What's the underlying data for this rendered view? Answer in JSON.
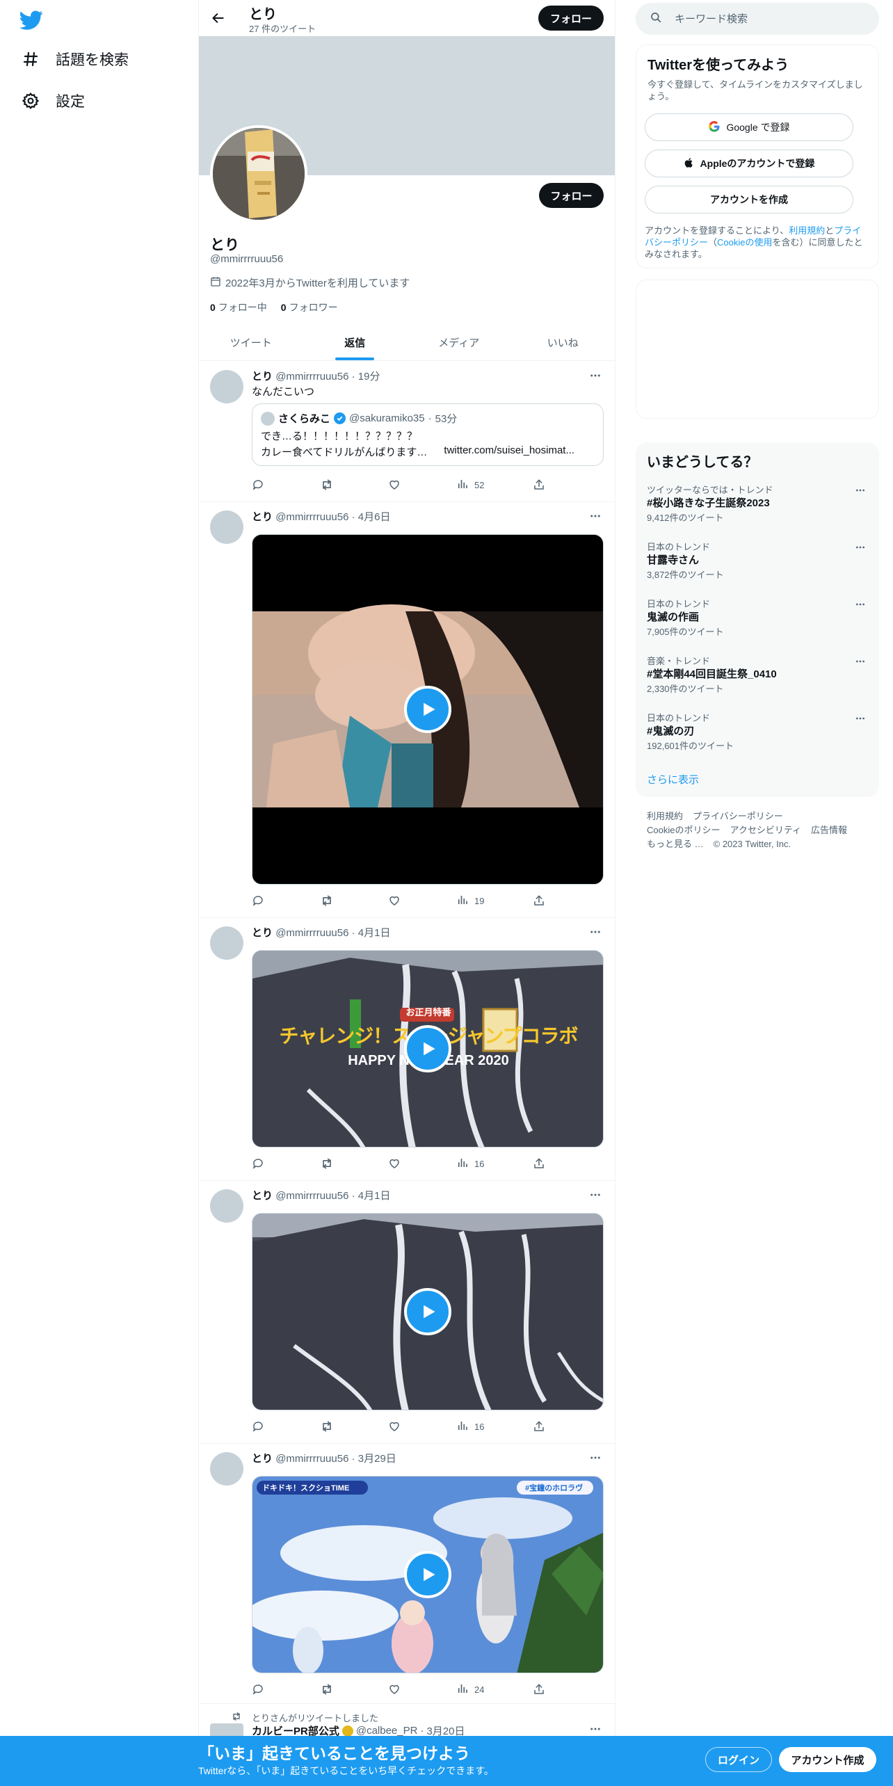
{
  "nav": {
    "items": [
      {
        "label": "話題を検索",
        "icon": "hashtag-icon"
      },
      {
        "label": "設定",
        "icon": "gear-icon"
      }
    ]
  },
  "header": {
    "name": "とり",
    "tweet_count": "27 件のツイート",
    "follow_label": "フォロー"
  },
  "profile": {
    "name": "とり",
    "handle": "@mmirrrruuu56",
    "joined": "2022年3月からTwitterを利用しています",
    "following_count": "0",
    "following_label": "フォロー中",
    "followers_count": "0",
    "followers_label": "フォロワー",
    "follow_label": "フォロー"
  },
  "tabs": [
    {
      "label": "ツイート",
      "active": false
    },
    {
      "label": "返信",
      "active": true
    },
    {
      "label": "メディア",
      "active": false
    },
    {
      "label": "いいね",
      "active": false
    }
  ],
  "tweets": [
    {
      "name": "とり",
      "handle": "@mmirrrruuu56",
      "time": "19分",
      "text": "なんだこいつ",
      "quote": {
        "name": "さくらみこ",
        "handle": "@sakuramiko35",
        "time": "53分",
        "line1": "でき…る！！！！！！？？？？？",
        "line2": "カレー食べてドリルがんばります…",
        "link": "twitter.com/suisei_hosimat..."
      },
      "views": "52"
    },
    {
      "name": "とり",
      "handle": "@mmirrrruuu56",
      "time": "4月6日",
      "views": "19"
    },
    {
      "name": "とり",
      "handle": "@mmirrrruuu56",
      "time": "4月1日",
      "views": "16",
      "media_texts": [
        "お正月特番",
        "チャレンジ！スキージャンプコラボ",
        "HAPPY NEW YEAR 2020"
      ]
    },
    {
      "name": "とり",
      "handle": "@mmirrrruuu56",
      "time": "4月1日",
      "views": "16"
    },
    {
      "name": "とり",
      "handle": "@mmirrrruuu56",
      "time": "3月29日",
      "views": "24",
      "media_texts": [
        "ドキドキ！スクショTIME",
        "#宝鐘のホロラヴ"
      ]
    }
  ],
  "retweet": {
    "label": "とりさんがリツイートしました",
    "name": "カルビーPR部公式",
    "handle": "@calbee_PR",
    "time": "3月20日"
  },
  "search": {
    "placeholder": "キーワード検索"
  },
  "signup_card": {
    "title": "Twitterを使ってみよう",
    "subtitle": "今すぐ登録して、タイムラインをカスタマイズしましょう。",
    "google": "Google で登録",
    "apple": "Appleのアカウントで登録",
    "create": "アカウントを作成",
    "legal_1": "アカウントを登録することにより、",
    "legal_terms": "利用規約",
    "legal_2": "と",
    "legal_privacy": "プライバシーポリシー",
    "legal_3": "（",
    "legal_cookie": "Cookieの使用",
    "legal_4": "を含む）に同意したとみなされます。"
  },
  "trends": {
    "title": "いまどうしてる？",
    "items": [
      {
        "context": "ツイッターならでは・トレンド",
        "name": "#桜小路きな子生誕祭2023",
        "count": "9,412件のツイート"
      },
      {
        "context": "日本のトレンド",
        "name": "甘露寺さん",
        "count": "3,872件のツイート"
      },
      {
        "context": "日本のトレンド",
        "name": "鬼滅の作画",
        "count": "7,905件のツイート"
      },
      {
        "context": "音楽・トレンド",
        "name": "#堂本剛44回目誕生祭_0410",
        "count": "2,330件のツイート"
      },
      {
        "context": "日本のトレンド",
        "name": "#鬼滅の刃",
        "count": "192,601件のツイート"
      }
    ],
    "show_more": "さらに表示"
  },
  "footer": {
    "links": [
      "利用規約",
      "プライバシーポリシー",
      "Cookieのポリシー",
      "アクセシビリティ",
      "広告情報",
      "もっと見る …"
    ],
    "copyright": "© 2023 Twitter, Inc."
  },
  "bottom_bar": {
    "title": "「いま」起きていることを見つけよう",
    "subtitle": "Twitterなら、「いま」起きていることをいち早くチェックできます。",
    "login": "ログイン",
    "signup": "アカウント作成"
  },
  "colors": {
    "accent": "#1d9bf0",
    "banner": "#cfd9de",
    "trend_bg": "#f7f9f9",
    "text_secondary": "#536471"
  }
}
